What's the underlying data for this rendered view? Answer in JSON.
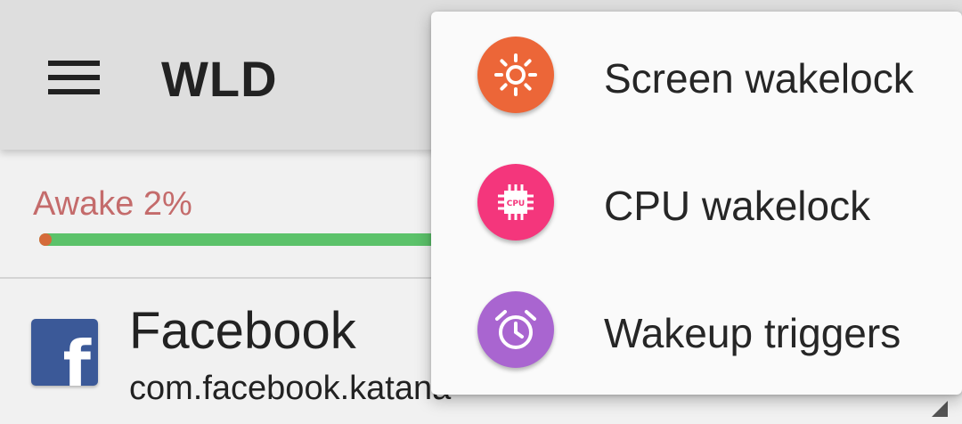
{
  "toolbar": {
    "title": "WLD",
    "menu_icon": "hamburger-menu-icon"
  },
  "summary": {
    "awake_label": "Awake 2%",
    "awake_fraction": 0.02,
    "colors": {
      "awake": "#d56b3a",
      "asleep": "#5cc26a",
      "label": "#c46b6b"
    }
  },
  "app_list": [
    {
      "name": "Facebook",
      "package": "com.facebook.katana",
      "icon": "facebook-icon",
      "icon_glyph": "f"
    }
  ],
  "menu": {
    "items": [
      {
        "label": "Screen wakelock",
        "icon": "sun-icon",
        "color": "#ec6638"
      },
      {
        "label": "CPU wakelock",
        "icon": "cpu-chip-icon",
        "color": "#f4367c",
        "icon_text": "CPU"
      },
      {
        "label": "Wakeup triggers",
        "icon": "alarm-clock-icon",
        "color": "#a965d0"
      }
    ]
  }
}
